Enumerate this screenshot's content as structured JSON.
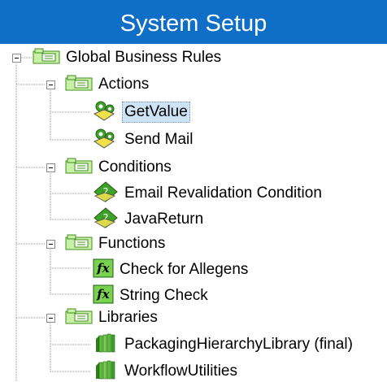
{
  "header": {
    "title": "System Setup"
  },
  "tree": {
    "root": {
      "label": "Global Business Rules",
      "icon": "folder-icon",
      "expanded": true
    },
    "groups": [
      {
        "label": "Actions",
        "icon": "folder-icon",
        "expanded": true,
        "items": [
          {
            "label": "GetValue",
            "icon": "action-icon",
            "selected": true
          },
          {
            "label": "Send Mail",
            "icon": "action-icon",
            "selected": false
          }
        ]
      },
      {
        "label": "Conditions",
        "icon": "folder-icon",
        "expanded": true,
        "items": [
          {
            "label": "Email Revalidation Condition",
            "icon": "condition-icon",
            "selected": false
          },
          {
            "label": "JavaReturn",
            "icon": "condition-icon",
            "selected": false
          }
        ]
      },
      {
        "label": "Functions",
        "icon": "folder-icon",
        "expanded": true,
        "items": [
          {
            "label": "Check for Allegens",
            "icon": "function-icon",
            "selected": false
          },
          {
            "label": "String Check",
            "icon": "function-icon",
            "selected": false
          }
        ]
      },
      {
        "label": "Libraries",
        "icon": "folder-icon",
        "expanded": true,
        "items": [
          {
            "label": "PackagingHierarchyLibrary (final)",
            "icon": "library-icon",
            "selected": false
          },
          {
            "label": "WorkflowUtilities",
            "icon": "library-icon",
            "selected": false
          }
        ]
      }
    ]
  },
  "colors": {
    "header_bg": "#0f6fc6",
    "header_text": "#ffffff",
    "selection_bg": "#cfe3f7"
  }
}
